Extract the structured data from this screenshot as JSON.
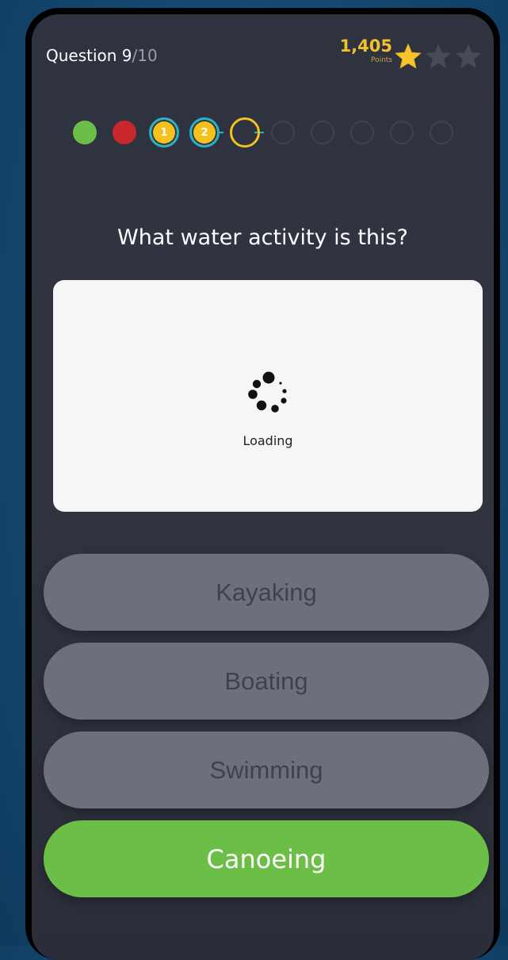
{
  "header": {
    "question_label": "Question 9",
    "question_total": "/10",
    "points_value": "1,405",
    "points_unit": "Points",
    "stars_earned": 1,
    "stars_total": 3,
    "colors": {
      "gold": "#f2c22c",
      "star_inactive": "#474b56"
    }
  },
  "progress": {
    "dots": [
      {
        "state": "correct",
        "color": "#6cbf46"
      },
      {
        "state": "wrong",
        "color": "#c7272d"
      },
      {
        "state": "numbered",
        "label": "1"
      },
      {
        "state": "numbered",
        "label": "2"
      },
      {
        "state": "current"
      },
      {
        "state": "upcoming"
      },
      {
        "state": "upcoming"
      },
      {
        "state": "upcoming"
      },
      {
        "state": "upcoming"
      },
      {
        "state": "upcoming"
      }
    ]
  },
  "question": {
    "text": "What water activity is this?"
  },
  "image": {
    "loading_text": "Loading",
    "icon": "loading-spinner-icon"
  },
  "answers": [
    {
      "label": "Kayaking",
      "state": "disabled"
    },
    {
      "label": "Boating",
      "state": "disabled"
    },
    {
      "label": "Swimming",
      "state": "disabled"
    },
    {
      "label": "Canoeing",
      "state": "correct",
      "color": "#6cbf46"
    }
  ]
}
